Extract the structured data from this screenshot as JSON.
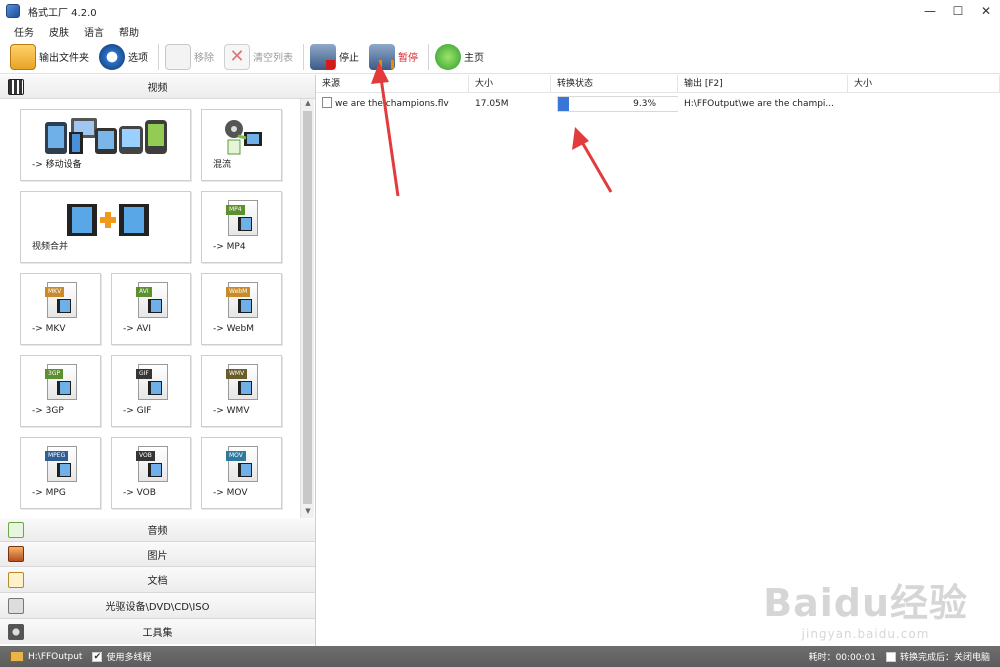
{
  "window": {
    "title": "格式工厂 4.2.0",
    "minimize": "—",
    "maximize": "☐",
    "close": "✕"
  },
  "menu": [
    "任务",
    "皮肤",
    "语言",
    "帮助"
  ],
  "toolbar": {
    "output_folder": "输出文件夹",
    "options": "选项",
    "remove": "移除",
    "clear_list": "清空列表",
    "stop": "停止",
    "pause": "暂停",
    "home": "主页"
  },
  "sidebar": {
    "video_header": "视频",
    "tiles": [
      {
        "label": "-> 移动设备"
      },
      {
        "label": "混流"
      },
      {
        "label": "视频合并"
      },
      {
        "label": "-> MP4",
        "tag": "MP4"
      },
      {
        "label": "-> MKV",
        "tag": "MKV"
      },
      {
        "label": "-> AVI",
        "tag": "AVI"
      },
      {
        "label": "-> WebM",
        "tag": "WebM"
      },
      {
        "label": "-> 3GP",
        "tag": "3GP"
      },
      {
        "label": "-> GIF",
        "tag": "GIF"
      },
      {
        "label": "-> WMV",
        "tag": "WMV"
      },
      {
        "label": "-> MPG",
        "tag": "MPEG"
      },
      {
        "label": "-> VOB",
        "tag": "VOB"
      },
      {
        "label": "-> MOV",
        "tag": "MOV"
      }
    ],
    "categories": [
      "音频",
      "图片",
      "文档",
      "光驱设备\\DVD\\CD\\ISO",
      "工具集"
    ]
  },
  "task_list": {
    "columns": [
      "来源",
      "大小",
      "转换状态",
      "输出 [F2]",
      "大小"
    ],
    "rows": [
      {
        "source": "we are the champions.flv",
        "size": "17.05M",
        "progress_text": "9.3%",
        "progress": 0.093,
        "output": "H:\\FFOutput\\we are the champi...",
        "out_size": ""
      }
    ]
  },
  "watermark": {
    "line1": "Baidu经验",
    "line2": "jingyan.baidu.com"
  },
  "statusbar": {
    "output_path": "H:\\FFOutput",
    "multithread_label": "使用多线程",
    "multithread_checked": "✔",
    "elapsed": "耗时：00:00:01",
    "after_done": "转换完成后：关闭电脑"
  }
}
